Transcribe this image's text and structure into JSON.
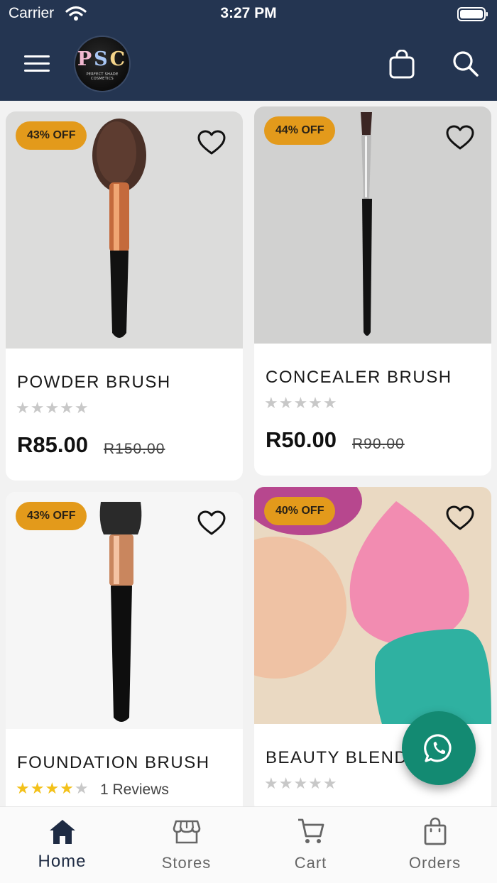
{
  "status_bar": {
    "carrier": "Carrier",
    "time": "3:27 PM"
  },
  "header": {
    "logo": {
      "letters": [
        "P",
        "S",
        "C"
      ],
      "subtitle": "PERFECT SHADE COSMETICS"
    },
    "icons": [
      "menu-icon",
      "shopping-bag-icon",
      "search-icon"
    ]
  },
  "products": [
    {
      "name": "POWDER BRUSH",
      "discount": "43% OFF",
      "price": "R85.00",
      "old_price": "R150.00",
      "rating": 0,
      "reviews": ""
    },
    {
      "name": "CONCEALER BRUSH",
      "discount": "44% OFF",
      "price": "R50.00",
      "old_price": "R90.00",
      "rating": 0,
      "reviews": ""
    },
    {
      "name": "FOUNDATION BRUSH",
      "discount": "43% OFF",
      "price": "",
      "old_price": "",
      "rating": 4,
      "reviews": "1 Reviews"
    },
    {
      "name": "BEAUTY BLENDER",
      "discount": "40% OFF",
      "price": "",
      "old_price": "",
      "rating": 0,
      "reviews": ""
    }
  ],
  "bottom_nav": {
    "items": [
      {
        "label": "Home",
        "icon": "home-icon",
        "active": true
      },
      {
        "label": "Stores",
        "icon": "store-icon",
        "active": false
      },
      {
        "label": "Cart",
        "icon": "cart-icon",
        "active": false
      },
      {
        "label": "Orders",
        "icon": "orders-bag-icon",
        "active": false
      }
    ]
  },
  "fab": {
    "icon": "whatsapp-icon"
  },
  "colors": {
    "header_bg": "#243551",
    "badge_bg": "#e39a1b",
    "star_on": "#f3c11a",
    "star_off": "#c8c8c8",
    "whatsapp_green": "#138a72",
    "nav_active": "#1e2b43"
  }
}
